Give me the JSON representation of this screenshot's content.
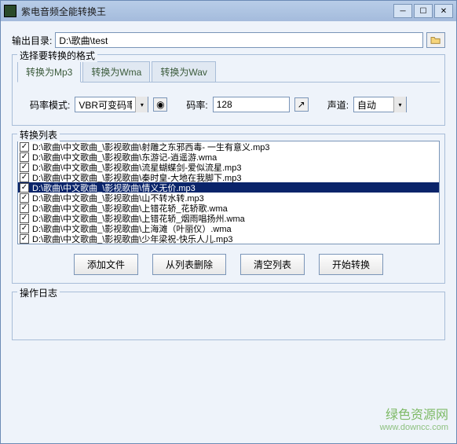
{
  "window": {
    "title": "紫电音频全能转换王"
  },
  "output": {
    "label": "输出目录:",
    "path": "D:\\歌曲\\test"
  },
  "format_section": {
    "legend": "选择要转换的格式"
  },
  "tabs": [
    {
      "label": "转换为Mp3",
      "active": true
    },
    {
      "label": "转换为Wma",
      "active": false
    },
    {
      "label": "转换为Wav",
      "active": false
    }
  ],
  "params": {
    "bitrate_mode_label": "码率模式:",
    "bitrate_mode_value": "VBR可变码率",
    "bitrate_label": "码率:",
    "bitrate_value": "128",
    "channel_label": "声道:",
    "channel_value": "自动"
  },
  "list": {
    "legend": "转换列表",
    "items": [
      {
        "path": "D:\\歌曲\\中文歌曲_\\影视歌曲\\射雕之东邪西毒- 一生有意义.mp3",
        "checked": true,
        "selected": false
      },
      {
        "path": "D:\\歌曲\\中文歌曲_\\影视歌曲\\东游记-逍遥游.wma",
        "checked": true,
        "selected": false
      },
      {
        "path": "D:\\歌曲\\中文歌曲_\\影视歌曲\\流星蝴蝶剑-爱似流星.mp3",
        "checked": true,
        "selected": false
      },
      {
        "path": "D:\\歌曲\\中文歌曲_\\影视歌曲\\秦时皇-大地在我脚下.mp3",
        "checked": true,
        "selected": false
      },
      {
        "path": "D:\\歌曲\\中文歌曲_\\影视歌曲\\情义无价.mp3",
        "checked": true,
        "selected": true
      },
      {
        "path": "D:\\歌曲\\中文歌曲_\\影视歌曲\\山不转水转.mp3",
        "checked": true,
        "selected": false
      },
      {
        "path": "D:\\歌曲\\中文歌曲_\\影视歌曲\\上错花轿_花轿歌.wma",
        "checked": true,
        "selected": false
      },
      {
        "path": "D:\\歌曲\\中文歌曲_\\影视歌曲\\上错花轿_烟雨唱扬州.wma",
        "checked": true,
        "selected": false
      },
      {
        "path": "D:\\歌曲\\中文歌曲_\\影视歌曲\\上海滩（叶丽仪）.wma",
        "checked": true,
        "selected": false
      },
      {
        "path": "D:\\歌曲\\中文歌曲_\\影视歌曲\\少年梁祝-快乐人儿.mp3",
        "checked": true,
        "selected": false
      }
    ]
  },
  "buttons": {
    "add": "添加文件",
    "remove": "从列表删除",
    "clear": "清空列表",
    "start": "开始转换"
  },
  "log": {
    "legend": "操作日志"
  },
  "watermark": {
    "name": "绿色资源网",
    "url": "www.downcc.com"
  }
}
